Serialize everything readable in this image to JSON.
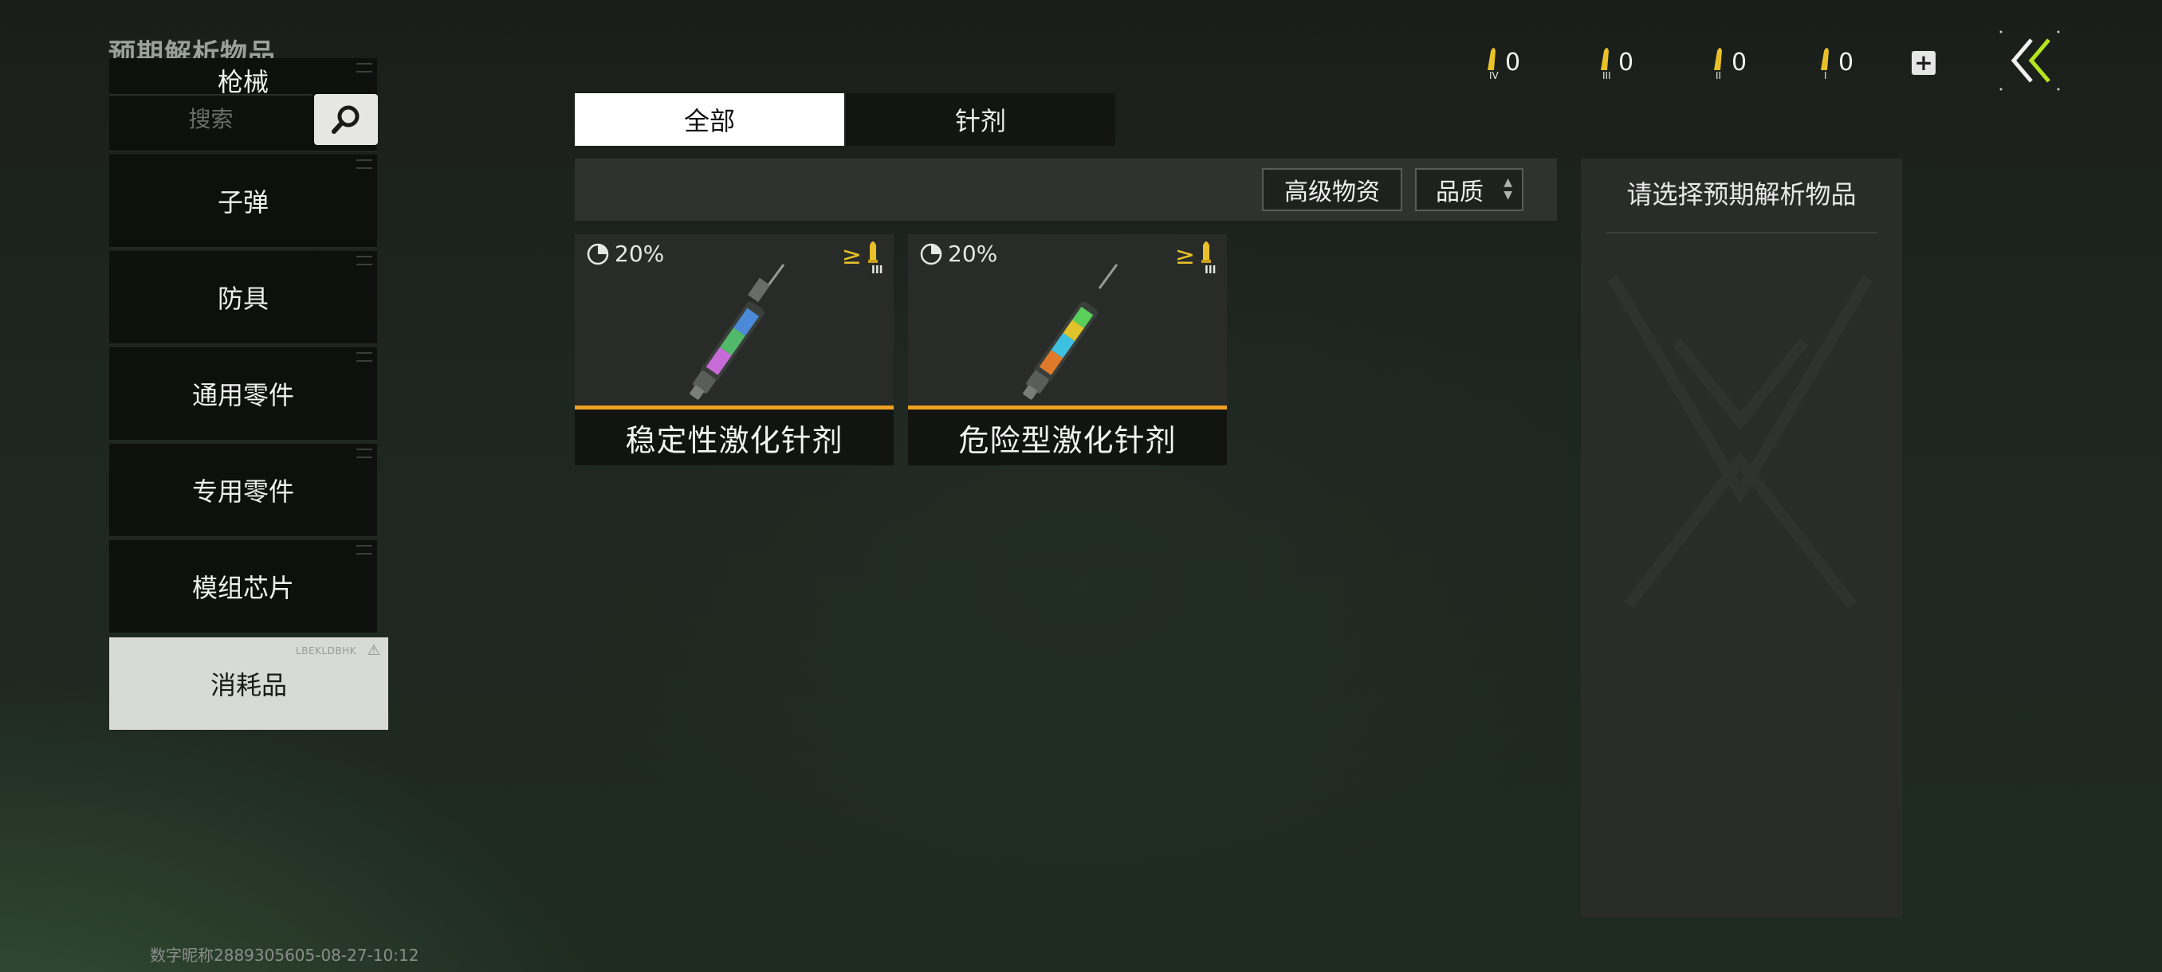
{
  "page": {
    "title": "预期解析物品"
  },
  "search": {
    "placeholder": "搜索"
  },
  "categories": [
    {
      "label": "枪械"
    },
    {
      "label": "子弹"
    },
    {
      "label": "防具"
    },
    {
      "label": "通用零件"
    },
    {
      "label": "专用零件"
    },
    {
      "label": "模组芯片"
    },
    {
      "label": "消耗品",
      "tag": "LBEKLDBHK",
      "active": true
    }
  ],
  "tabs": [
    {
      "label": "全部",
      "active": true
    },
    {
      "label": "针剂",
      "active": false
    }
  ],
  "filters": {
    "advanced_label": "高级物资",
    "quality_label": "品质"
  },
  "items": [
    {
      "chance": "20%",
      "tier_prefix": "≥",
      "tier_mark": "III",
      "name": "稳定性激化针剂"
    },
    {
      "chance": "20%",
      "tier_prefix": "≥",
      "tier_mark": "III",
      "name": "危险型激化针剂"
    }
  ],
  "detail": {
    "title": "请选择预期解析物品"
  },
  "currency": [
    {
      "mark": "IV",
      "count": "0"
    },
    {
      "mark": "III",
      "count": "0"
    },
    {
      "mark": "II",
      "count": "0"
    },
    {
      "mark": "I",
      "count": "0"
    }
  ],
  "watermark": "数字昵称2889305605-08-27-10:12",
  "colors": {
    "accent_orange": "#f0a020",
    "tier_gold": "#e8c12a",
    "back_arrow_green": "#b5e61d"
  },
  "icons": {
    "search": "search-icon",
    "chance": "pie-chance-icon",
    "bullet": "bullet-icon",
    "plus": "plus-icon",
    "back": "double-chevron-left-icon"
  }
}
